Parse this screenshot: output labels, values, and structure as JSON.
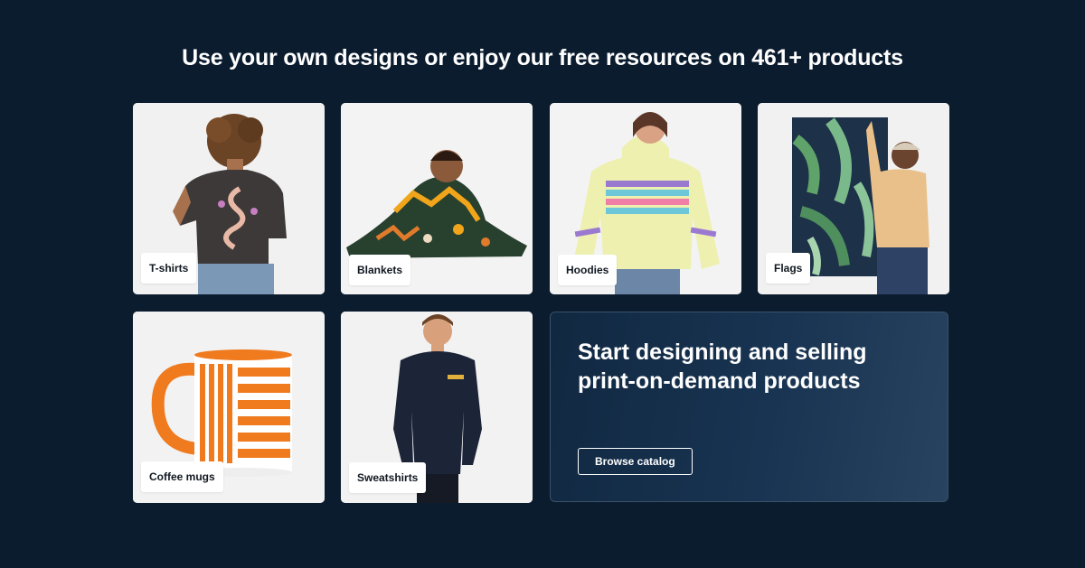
{
  "headline": "Use your own designs or enjoy our free resources on 461+ products",
  "products": [
    {
      "label": "T-shirts",
      "icon": "t-shirt-product-image"
    },
    {
      "label": "Blankets",
      "icon": "blanket-product-image"
    },
    {
      "label": "Hoodies",
      "icon": "hoodie-product-image"
    },
    {
      "label": "Flags",
      "icon": "flag-product-image"
    },
    {
      "label": "Coffee mugs",
      "icon": "coffee-mug-product-image"
    },
    {
      "label": "Sweatshirts",
      "icon": "sweatshirt-product-image"
    }
  ],
  "promo": {
    "title": "Start designing and selling print-on-demand products",
    "button_label": "Browse catalog"
  },
  "colors": {
    "background": "#0b1c2f",
    "card": "#f2f2f2",
    "accent_orange": "#f07a1e"
  }
}
